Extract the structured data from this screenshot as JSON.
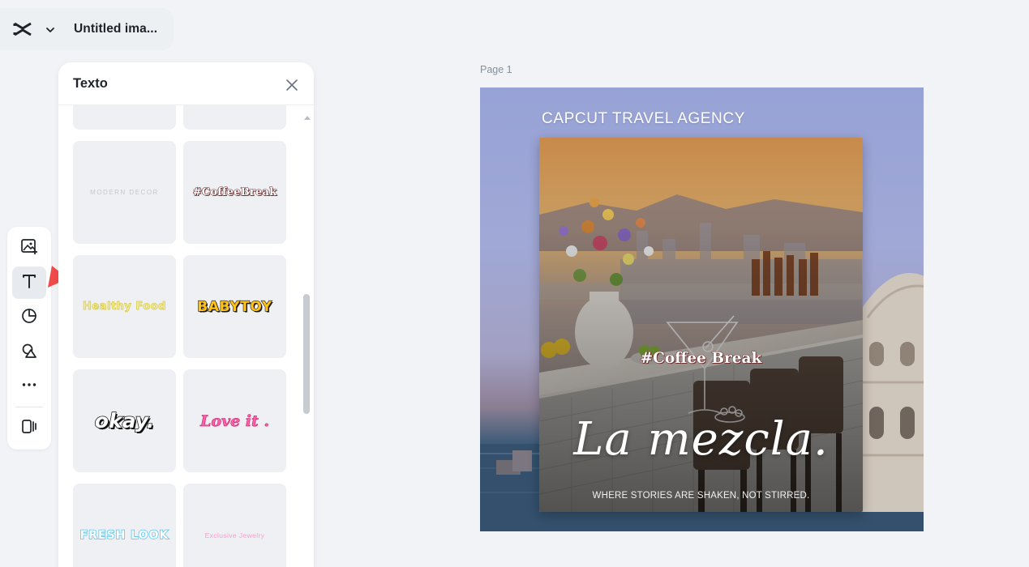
{
  "header": {
    "title": "Untitled ima..."
  },
  "tool_rail": {
    "tools": [
      {
        "name": "image-add-icon",
        "active": false
      },
      {
        "name": "text-icon",
        "active": true
      },
      {
        "name": "shapes-icon",
        "active": false
      },
      {
        "name": "elements-icon",
        "active": false
      },
      {
        "name": "more-icon",
        "active": false
      },
      {
        "name": "panel-toggle-icon",
        "active": false
      }
    ]
  },
  "text_panel": {
    "title": "Texto",
    "presets": [
      {
        "text": "MODERN DECOR"
      },
      {
        "text": "#CoffeeBreak"
      },
      {
        "text": "Healthy Food"
      },
      {
        "text": "BABYTOY"
      },
      {
        "text": "okay."
      },
      {
        "text": "Love it ."
      },
      {
        "text": "FRESH LOOK"
      },
      {
        "text": "Exclusive Jewelry"
      }
    ]
  },
  "canvas": {
    "page_label": "Page 1",
    "agency": "CAPCUT TRAVEL AGENCY",
    "hashtag": "#Coffee Break",
    "script_title": "La mezcla.",
    "tagline": "WHERE STORIES ARE SHAKEN, NOT STIRRED."
  },
  "colors": {
    "background": "#f1f3f6",
    "panel": "#ffffff",
    "card": "#eef0f3",
    "annotation_arrow": "#f04a4a",
    "canvas_top": "#97a2d6"
  }
}
